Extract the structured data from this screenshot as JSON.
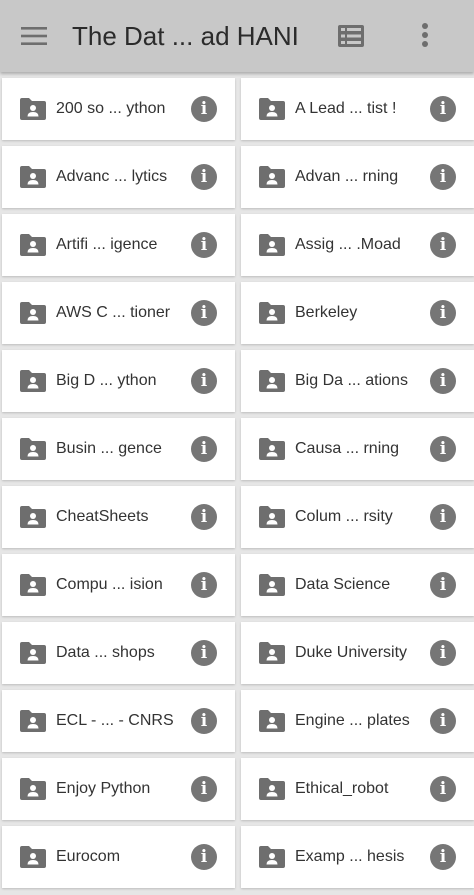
{
  "appbar": {
    "title": "The Dat ... ad HANI",
    "menu_icon": "hamburger-menu-icon",
    "view_icon": "list-view-icon",
    "more_icon": "more-vert-icon"
  },
  "colors": {
    "appbar": "#c8c8c8",
    "icon": "#6e6e6e",
    "card": "#ffffff"
  },
  "folders": [
    {
      "label": "200 so ... ython"
    },
    {
      "label": "A Lead ... tist !"
    },
    {
      "label": "Advanc ... lytics"
    },
    {
      "label": "Advan ... rning"
    },
    {
      "label": "Artifi ... igence"
    },
    {
      "label": "Assig ... .Moad"
    },
    {
      "label": "AWS C ... tioner"
    },
    {
      "label": "Berkeley"
    },
    {
      "label": "Big D ... ython"
    },
    {
      "label": "Big Da ... ations"
    },
    {
      "label": "Busin ... gence"
    },
    {
      "label": "Causa ... rning"
    },
    {
      "label": "CheatSheets"
    },
    {
      "label": "Colum ... rsity"
    },
    {
      "label": "Compu ... ision"
    },
    {
      "label": "Data Science"
    },
    {
      "label": "Data ... shops"
    },
    {
      "label": "Duke University"
    },
    {
      "label": "ECL - ... - CNRS"
    },
    {
      "label": "Engine ... plates"
    },
    {
      "label": "Enjoy Python"
    },
    {
      "label": "Ethical_robot"
    },
    {
      "label": "Eurocom"
    },
    {
      "label": "Examp ... hesis"
    }
  ],
  "info_glyph": "i"
}
